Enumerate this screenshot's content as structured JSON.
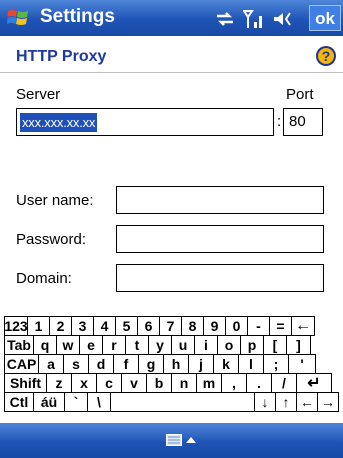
{
  "titlebar": {
    "title": "Settings",
    "ok_label": "ok"
  },
  "header": {
    "title": "HTTP Proxy"
  },
  "form": {
    "server_label": "Server",
    "port_label": "Port",
    "server_value": "xxx.xxx.xx.xx",
    "port_separator": ":",
    "port_value": "80",
    "user_label": "User name:",
    "password_label": "Password:",
    "domain_label": "Domain:"
  },
  "keyboard": {
    "rows": [
      [
        "123",
        "1",
        "2",
        "3",
        "4",
        "5",
        "6",
        "7",
        "8",
        "9",
        "0",
        "-",
        "=",
        "←"
      ],
      [
        "Tab",
        "q",
        "w",
        "e",
        "r",
        "t",
        "y",
        "u",
        "i",
        "o",
        "p",
        "[",
        "]"
      ],
      [
        "CAP",
        "a",
        "s",
        "d",
        "f",
        "g",
        "h",
        "j",
        "k",
        "l",
        ";",
        "'"
      ],
      [
        "Shift",
        "z",
        "x",
        "c",
        "v",
        "b",
        "n",
        "m",
        ",",
        ".",
        "/",
        "↵"
      ],
      [
        "Ctl",
        "áü",
        "`",
        "\\",
        "",
        "↓",
        "↑",
        "←",
        "→"
      ]
    ]
  },
  "colors": {
    "bar_blue": "#1f54b6",
    "title_blue": "#1d3a9a",
    "selection": "#1f4fb8"
  },
  "icons": [
    "windows-logo-icon",
    "connectivity-icon",
    "signal-icon",
    "volume-icon",
    "help-icon",
    "keyboard-icon",
    "sip-up-arrow-icon"
  ]
}
